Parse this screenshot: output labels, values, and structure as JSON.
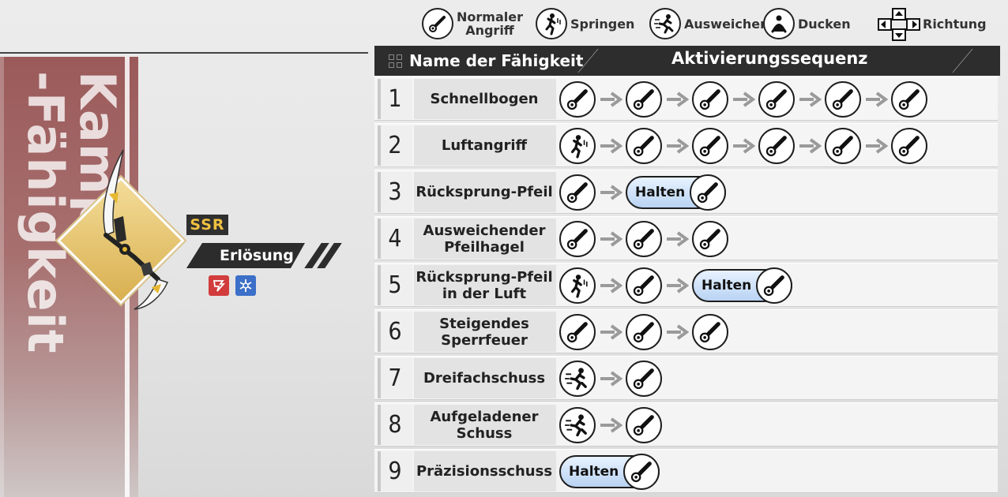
{
  "legend": {
    "items": [
      {
        "icon": "attack-icon",
        "label_line1": "Normaler",
        "label_line2": "Angriff"
      },
      {
        "icon": "jump-icon",
        "label": "Springen"
      },
      {
        "icon": "dodge-icon",
        "label": "Ausweichen"
      },
      {
        "icon": "crouch-icon",
        "label": "Ducken"
      },
      {
        "icon": "direction-icon",
        "label": "Richtung"
      }
    ]
  },
  "banner": {
    "title": "Kampf\n-Fähigkeit",
    "color": "#9b5a5a"
  },
  "weapon": {
    "rarity": "SSR",
    "name": "Erlösung",
    "element_icons": [
      "fire-element-icon",
      "ice-element-icon"
    ],
    "colors": {
      "fire": "#d23c3c",
      "ice": "#3c6fc8",
      "rarity": "#f0c040"
    }
  },
  "table": {
    "header_name": "Name der Fähigkeit",
    "header_sequence": "Aktivierungssequenz",
    "hold_label": "Halten",
    "rows": [
      {
        "num": "1",
        "name": "Schnellbogen",
        "seq": [
          "attack",
          "attack",
          "attack",
          "attack",
          "attack",
          "attack"
        ]
      },
      {
        "num": "2",
        "name": "Luftangriff",
        "seq": [
          "jump",
          "attack",
          "attack",
          "attack",
          "attack",
          "attack"
        ]
      },
      {
        "num": "3",
        "name": "Rücksprung-Pfeil",
        "seq": [
          "attack",
          "hold"
        ]
      },
      {
        "num": "4",
        "name": "Ausweichender Pfeilhagel",
        "seq": [
          "attack",
          "attack",
          "attack"
        ]
      },
      {
        "num": "5",
        "name": "Rücksprung-Pfeil in der Luft",
        "seq": [
          "jump",
          "attack",
          "hold"
        ]
      },
      {
        "num": "6",
        "name": "Steigendes Sperrfeuer",
        "seq": [
          "attack",
          "attack",
          "attack"
        ]
      },
      {
        "num": "7",
        "name": "Dreifachschuss",
        "seq": [
          "dodge",
          "attack"
        ]
      },
      {
        "num": "8",
        "name": "Aufgeladener Schuss",
        "seq": [
          "dodge",
          "attack"
        ]
      },
      {
        "num": "9",
        "name": "Präzisionsschuss",
        "seq": [
          "hold"
        ]
      }
    ]
  }
}
